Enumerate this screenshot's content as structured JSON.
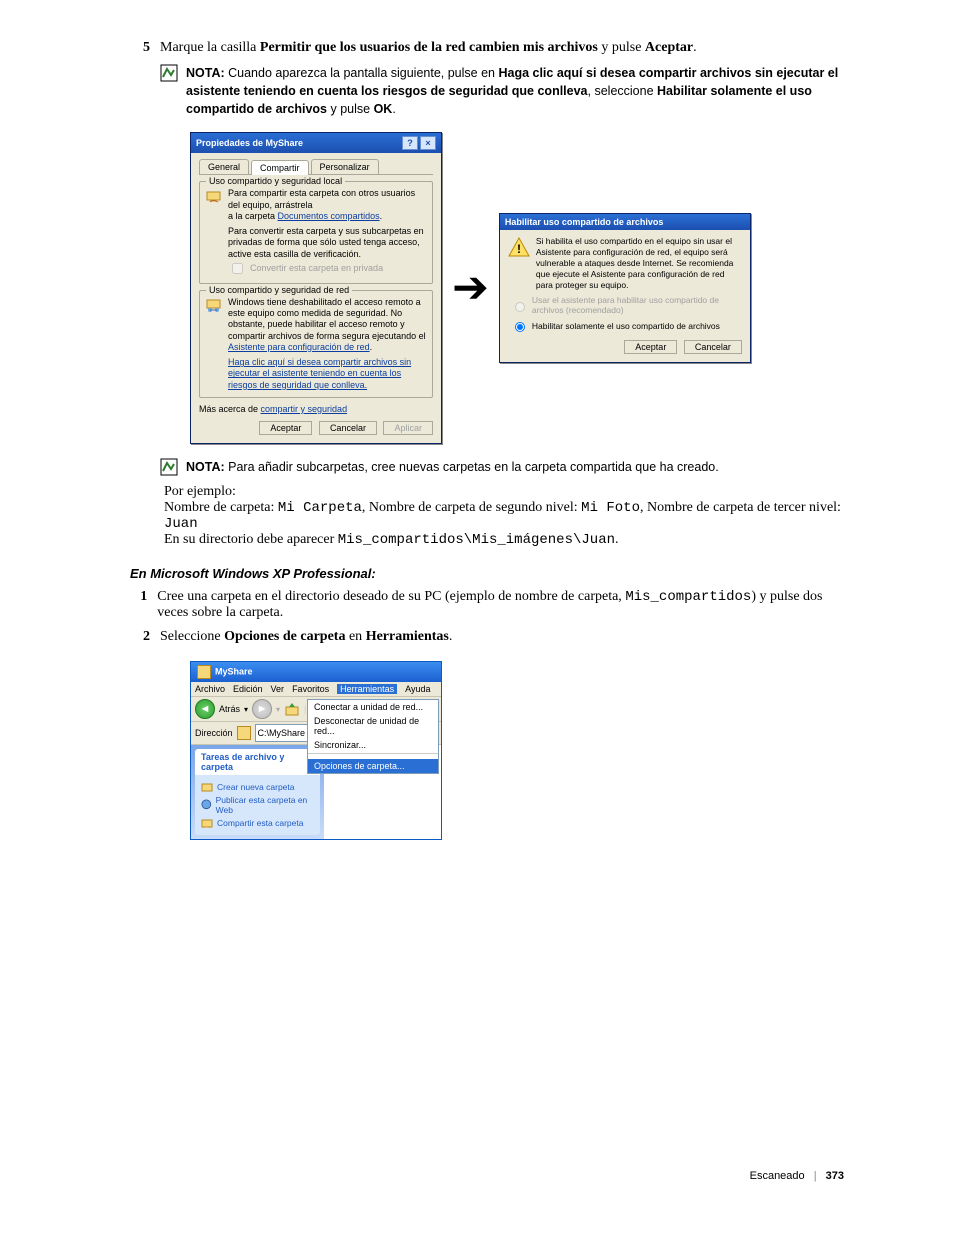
{
  "step5": {
    "num": "5",
    "lead": "Marque la casilla ",
    "bold1": "Permitir que los usuarios de la red cambien mis archivos",
    "mid": " y pulse ",
    "bold2": "Aceptar",
    "tail": "."
  },
  "note1": {
    "label": "NOTA: ",
    "t1": "Cuando aparezca la pantalla siguiente, pulse en ",
    "b1": "Haga clic aquí si desea compartir archivos sin ejecutar el asistente teniendo en cuenta los riesgos de seguridad que conlleva",
    "t2": ", seleccione ",
    "b2": "Habilitar solamente el uso compartido de archivos",
    "t3": " y pulse ",
    "b3": "OK",
    "t4": "."
  },
  "dlg1": {
    "title": "Propiedades de MyShare",
    "tabs": {
      "general": "General",
      "compartir": "Compartir",
      "personalizar": "Personalizar"
    },
    "grp1": {
      "title": "Uso compartido y seguridad local",
      "line1a": "Para compartir esta carpeta con otros usuarios del equipo, arrástrela",
      "line1b": "a la carpeta ",
      "link1": "Documentos compartidos",
      "line1c": ".",
      "line2": "Para convertir esta carpeta y sus subcarpetas en privadas de forma que sólo usted tenga acceso, active esta casilla de verificación.",
      "chk": "Convertir esta carpeta en privada"
    },
    "grp2": {
      "title": "Uso compartido y seguridad de red",
      "line1": "Windows tiene deshabilitado el acceso remoto a este equipo como medida de seguridad. No obstante, puede habilitar el acceso remoto y compartir archivos de forma segura ejecutando el ",
      "link1": "Asistente para configuración de red",
      "line1b": ".",
      "link2": "Haga clic aquí si desea compartir archivos sin ejecutar el asistente teniendo en cuenta los riesgos de seguridad que conlleva."
    },
    "morelink": "Más acerca de ",
    "morelink2": "compartir y seguridad",
    "btns": {
      "ok": "Aceptar",
      "cancel": "Cancelar",
      "apply": "Aplicar"
    }
  },
  "dlg2": {
    "title": "Habilitar uso compartido de archivos",
    "msg": "Si habilita el uso compartido en el equipo sin usar el Asistente para configuración de red, el equipo será vulnerable a ataques desde Internet. Se recomienda que ejecute el Asistente para configuración de red para proteger su equipo.",
    "r1": "Usar el asistente para habilitar uso compartido de archivos (recomendado)",
    "r2": "Habilitar solamente el uso compartido de archivos",
    "ok": "Aceptar",
    "cancel": "Cancelar"
  },
  "note2": {
    "label": "NOTA: ",
    "text": "Para añadir subcarpetas, cree nuevas carpetas en la carpeta compartida que ha creado."
  },
  "example": {
    "intro": "Por ejemplo:",
    "l1a": "Nombre de carpeta: ",
    "l1b": "Mi Carpeta",
    "l1c": ", Nombre de carpeta de segundo nivel: ",
    "l1d": "Mi Foto",
    "l1e": ", Nombre de carpeta de tercer nivel: ",
    "l1f": "Juan",
    "l2a": "En su directorio debe aparecer ",
    "l2b": "Mis_compartidos\\Mis_imágenes\\Juan",
    "l2c": "."
  },
  "subhead": "En Microsoft Windows XP Professional:",
  "step1": {
    "num": "1",
    "t1": "Cree una carpeta en el directorio deseado de su PC (ejemplo de nombre de carpeta, ",
    "m1": "Mis_compartidos",
    "t2": ") y pulse dos veces sobre la carpeta."
  },
  "step2": {
    "num": "2",
    "t1": "Seleccione ",
    "b1": "Opciones de carpeta",
    "t2": " en ",
    "b2": "Herramientas",
    "t3": "."
  },
  "explorer": {
    "title": "MyShare",
    "menu": {
      "archivo": "Archivo",
      "edicion": "Edición",
      "ver": "Ver",
      "favoritos": "Favoritos",
      "herramientas": "Herramientas",
      "ayuda": "Ayuda"
    },
    "back": "Atrás",
    "addr_label": "Dirección",
    "addr_value": "C:\\MyShare",
    "dropdown": {
      "d1": "Conectar a unidad de red...",
      "d2": "Desconectar de unidad de red...",
      "d3": "Sincronizar...",
      "d4": "Opciones de carpeta..."
    },
    "tasks_title": "Tareas de archivo y carpeta",
    "task1": "Crear nueva carpeta",
    "task2": "Publicar esta carpeta en Web",
    "task3": "Compartir esta carpeta"
  },
  "footer": {
    "section": "Escaneado",
    "page": "373"
  }
}
